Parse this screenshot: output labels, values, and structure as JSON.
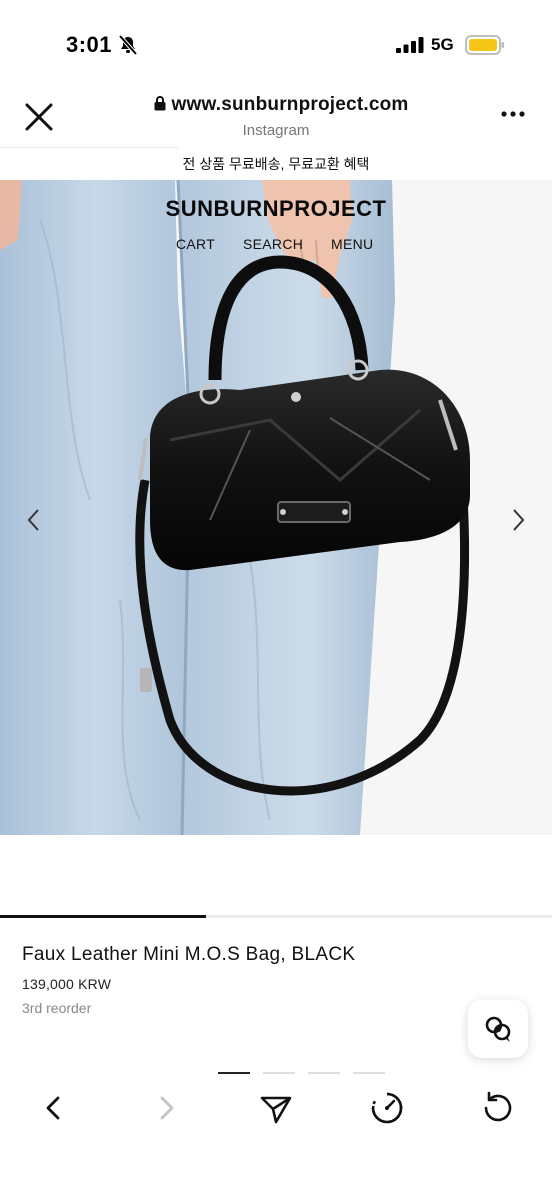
{
  "status_bar": {
    "time": "3:01",
    "network": "5G",
    "mute_icon": "bell-slash-icon",
    "battery_color": "#f5c518"
  },
  "browser": {
    "url": "www.sunburnproject.com",
    "subtitle": "Instagram",
    "close_icon": "close-icon",
    "more_icon": "more-icon"
  },
  "promo": {
    "text": "전 상품 무료배송, 무료교환 혜택"
  },
  "site": {
    "logo": "SUNBURNPROJECT",
    "nav": [
      "CART",
      "SEARCH",
      "MENU"
    ]
  },
  "product": {
    "title": "Faux Leather Mini M.O.S Bag, BLACK",
    "price": "139,000 KRW",
    "note": "3rd reorder"
  },
  "gallery": {
    "image_count": 4,
    "current_image": 1
  },
  "colors": {
    "accent": "#111111",
    "denim": "#b8cde0",
    "bag": "#141414"
  }
}
